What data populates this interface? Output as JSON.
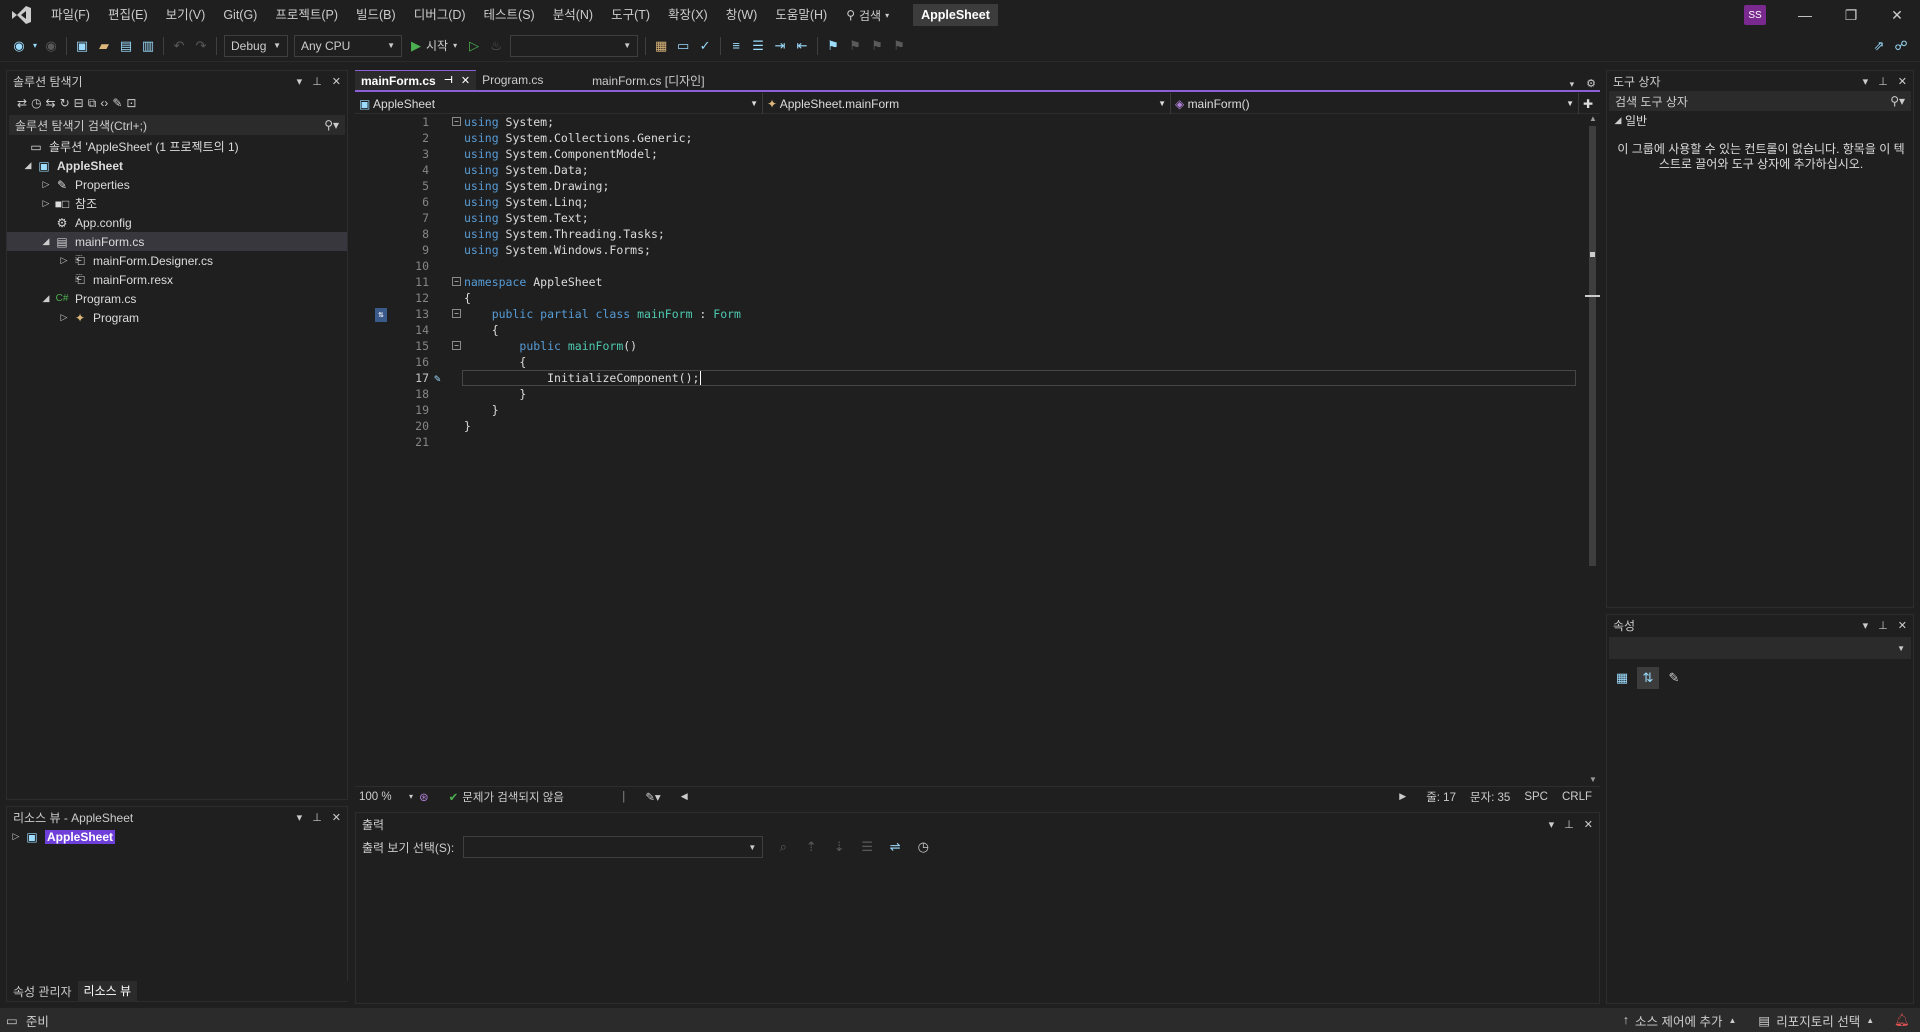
{
  "menu": [
    "파일(F)",
    "편집(E)",
    "보기(V)",
    "Git(G)",
    "프로젝트(P)",
    "빌드(B)",
    "디버그(D)",
    "테스트(S)",
    "분석(N)",
    "도구(T)",
    "확장(X)",
    "창(W)",
    "도움말(H)"
  ],
  "search_label": "검색",
  "app_title": "AppleSheet",
  "avatar_initials": "SS",
  "toolbar": {
    "config": "Debug",
    "platform": "Any CPU",
    "start_label": "시작"
  },
  "solution_explorer": {
    "title": "솔루션 탐색기",
    "search_placeholder": "솔루션 탐색기 검색(Ctrl+;)",
    "items": [
      {
        "label": "솔루션 'AppleSheet' (1 프로젝트의 1)"
      },
      {
        "label": "AppleSheet"
      },
      {
        "label": "Properties"
      },
      {
        "label": "참조"
      },
      {
        "label": "App.config"
      },
      {
        "label": "mainForm.cs"
      },
      {
        "label": "mainForm.Designer.cs"
      },
      {
        "label": "mainForm.resx"
      },
      {
        "label": "Program.cs"
      },
      {
        "label": "Program"
      }
    ]
  },
  "resource_view": {
    "title": "리소스 뷰 - AppleSheet",
    "item": "AppleSheet",
    "tabs": [
      "속성 관리자",
      "리소스 뷰"
    ]
  },
  "editor": {
    "tabs": [
      "mainForm.cs",
      "Program.cs",
      "mainForm.cs [디자인]"
    ],
    "nav": {
      "project": "AppleSheet",
      "class": "AppleSheet.mainForm",
      "member": "mainForm()"
    },
    "lines": [
      {
        "n": "1",
        "kw": "using",
        "rest": " System;"
      },
      {
        "n": "2",
        "kw": "using",
        "rest": " System.Collections.Generic;"
      },
      {
        "n": "3",
        "kw": "using",
        "rest": " System.ComponentModel;"
      },
      {
        "n": "4",
        "kw": "using",
        "rest": " System.Data;"
      },
      {
        "n": "5",
        "kw": "using",
        "rest": " System.Drawing;"
      },
      {
        "n": "6",
        "kw": "using",
        "rest": " System.Linq;"
      },
      {
        "n": "7",
        "kw": "using",
        "rest": " System.Text;"
      },
      {
        "n": "8",
        "kw": "using",
        "rest": " System.Threading.Tasks;"
      },
      {
        "n": "9",
        "kw": "using",
        "rest": " System.Windows.Forms;"
      },
      {
        "n": "10",
        "kw": "",
        "rest": ""
      },
      {
        "n": "11",
        "kw": "namespace",
        "rest": " AppleSheet"
      },
      {
        "n": "12",
        "kw": "",
        "rest": "{"
      },
      {
        "n": "13",
        "kw": "",
        "rest": ""
      },
      {
        "n": "14",
        "kw": "",
        "rest": "    {"
      },
      {
        "n": "15",
        "kw": "",
        "rest": ""
      },
      {
        "n": "16",
        "kw": "",
        "rest": "        {"
      },
      {
        "n": "17",
        "kw": "",
        "rest": ""
      },
      {
        "n": "18",
        "kw": "",
        "rest": "        }"
      },
      {
        "n": "19",
        "kw": "",
        "rest": "    }"
      },
      {
        "n": "20",
        "kw": "",
        "rest": "}"
      },
      {
        "n": "21",
        "kw": "",
        "rest": ""
      }
    ],
    "line13": {
      "a": "public partial class ",
      "b": "mainForm",
      "c": " : ",
      "d": "Form"
    },
    "line15": {
      "a": "public ",
      "b": "mainForm",
      "c": "()"
    },
    "line17": {
      "a": "InitializeComponent",
      "b": "();"
    },
    "zoom": "100 %",
    "issues": "문제가 검색되지 않음",
    "line_pos": "줄: 17",
    "col_pos": "문자: 35",
    "ws": "SPC",
    "eol": "CRLF"
  },
  "toolbox": {
    "title": "도구 상자",
    "search_placeholder": "검색 도구 상자",
    "group": "일반",
    "empty_message": "이 그룹에 사용할 수 있는 컨트롤이 없습니다. 항목을 이 텍스트로 끌어와 도구 상자에 추가하십시오."
  },
  "properties": {
    "title": "속성"
  },
  "output": {
    "title": "출력",
    "show_label": "출력 보기 선택(S):"
  },
  "status": {
    "ready": "준비",
    "source_control": "소스 제어에 추가",
    "repo": "리포지토리 선택"
  }
}
